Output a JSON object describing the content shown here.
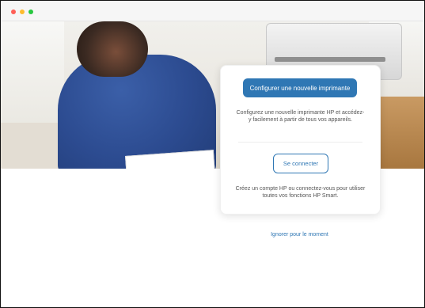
{
  "window": {
    "controls": [
      "close",
      "minimize",
      "zoom"
    ]
  },
  "setup": {
    "primary_button_label": "Configurer une nouvelle imprimante",
    "primary_description": "Configurez une nouvelle imprimante HP et accédez-y facilement à partir de tous vos appareils.",
    "signin_button_label": "Se connecter",
    "signin_description": "Créez un compte HP ou connectez-vous pour utiliser toutes vos fonctions HP Smart.",
    "skip_link_label": "Ignorer pour le moment"
  },
  "colors": {
    "accent": "#2f77b4",
    "text_muted": "#555555"
  }
}
